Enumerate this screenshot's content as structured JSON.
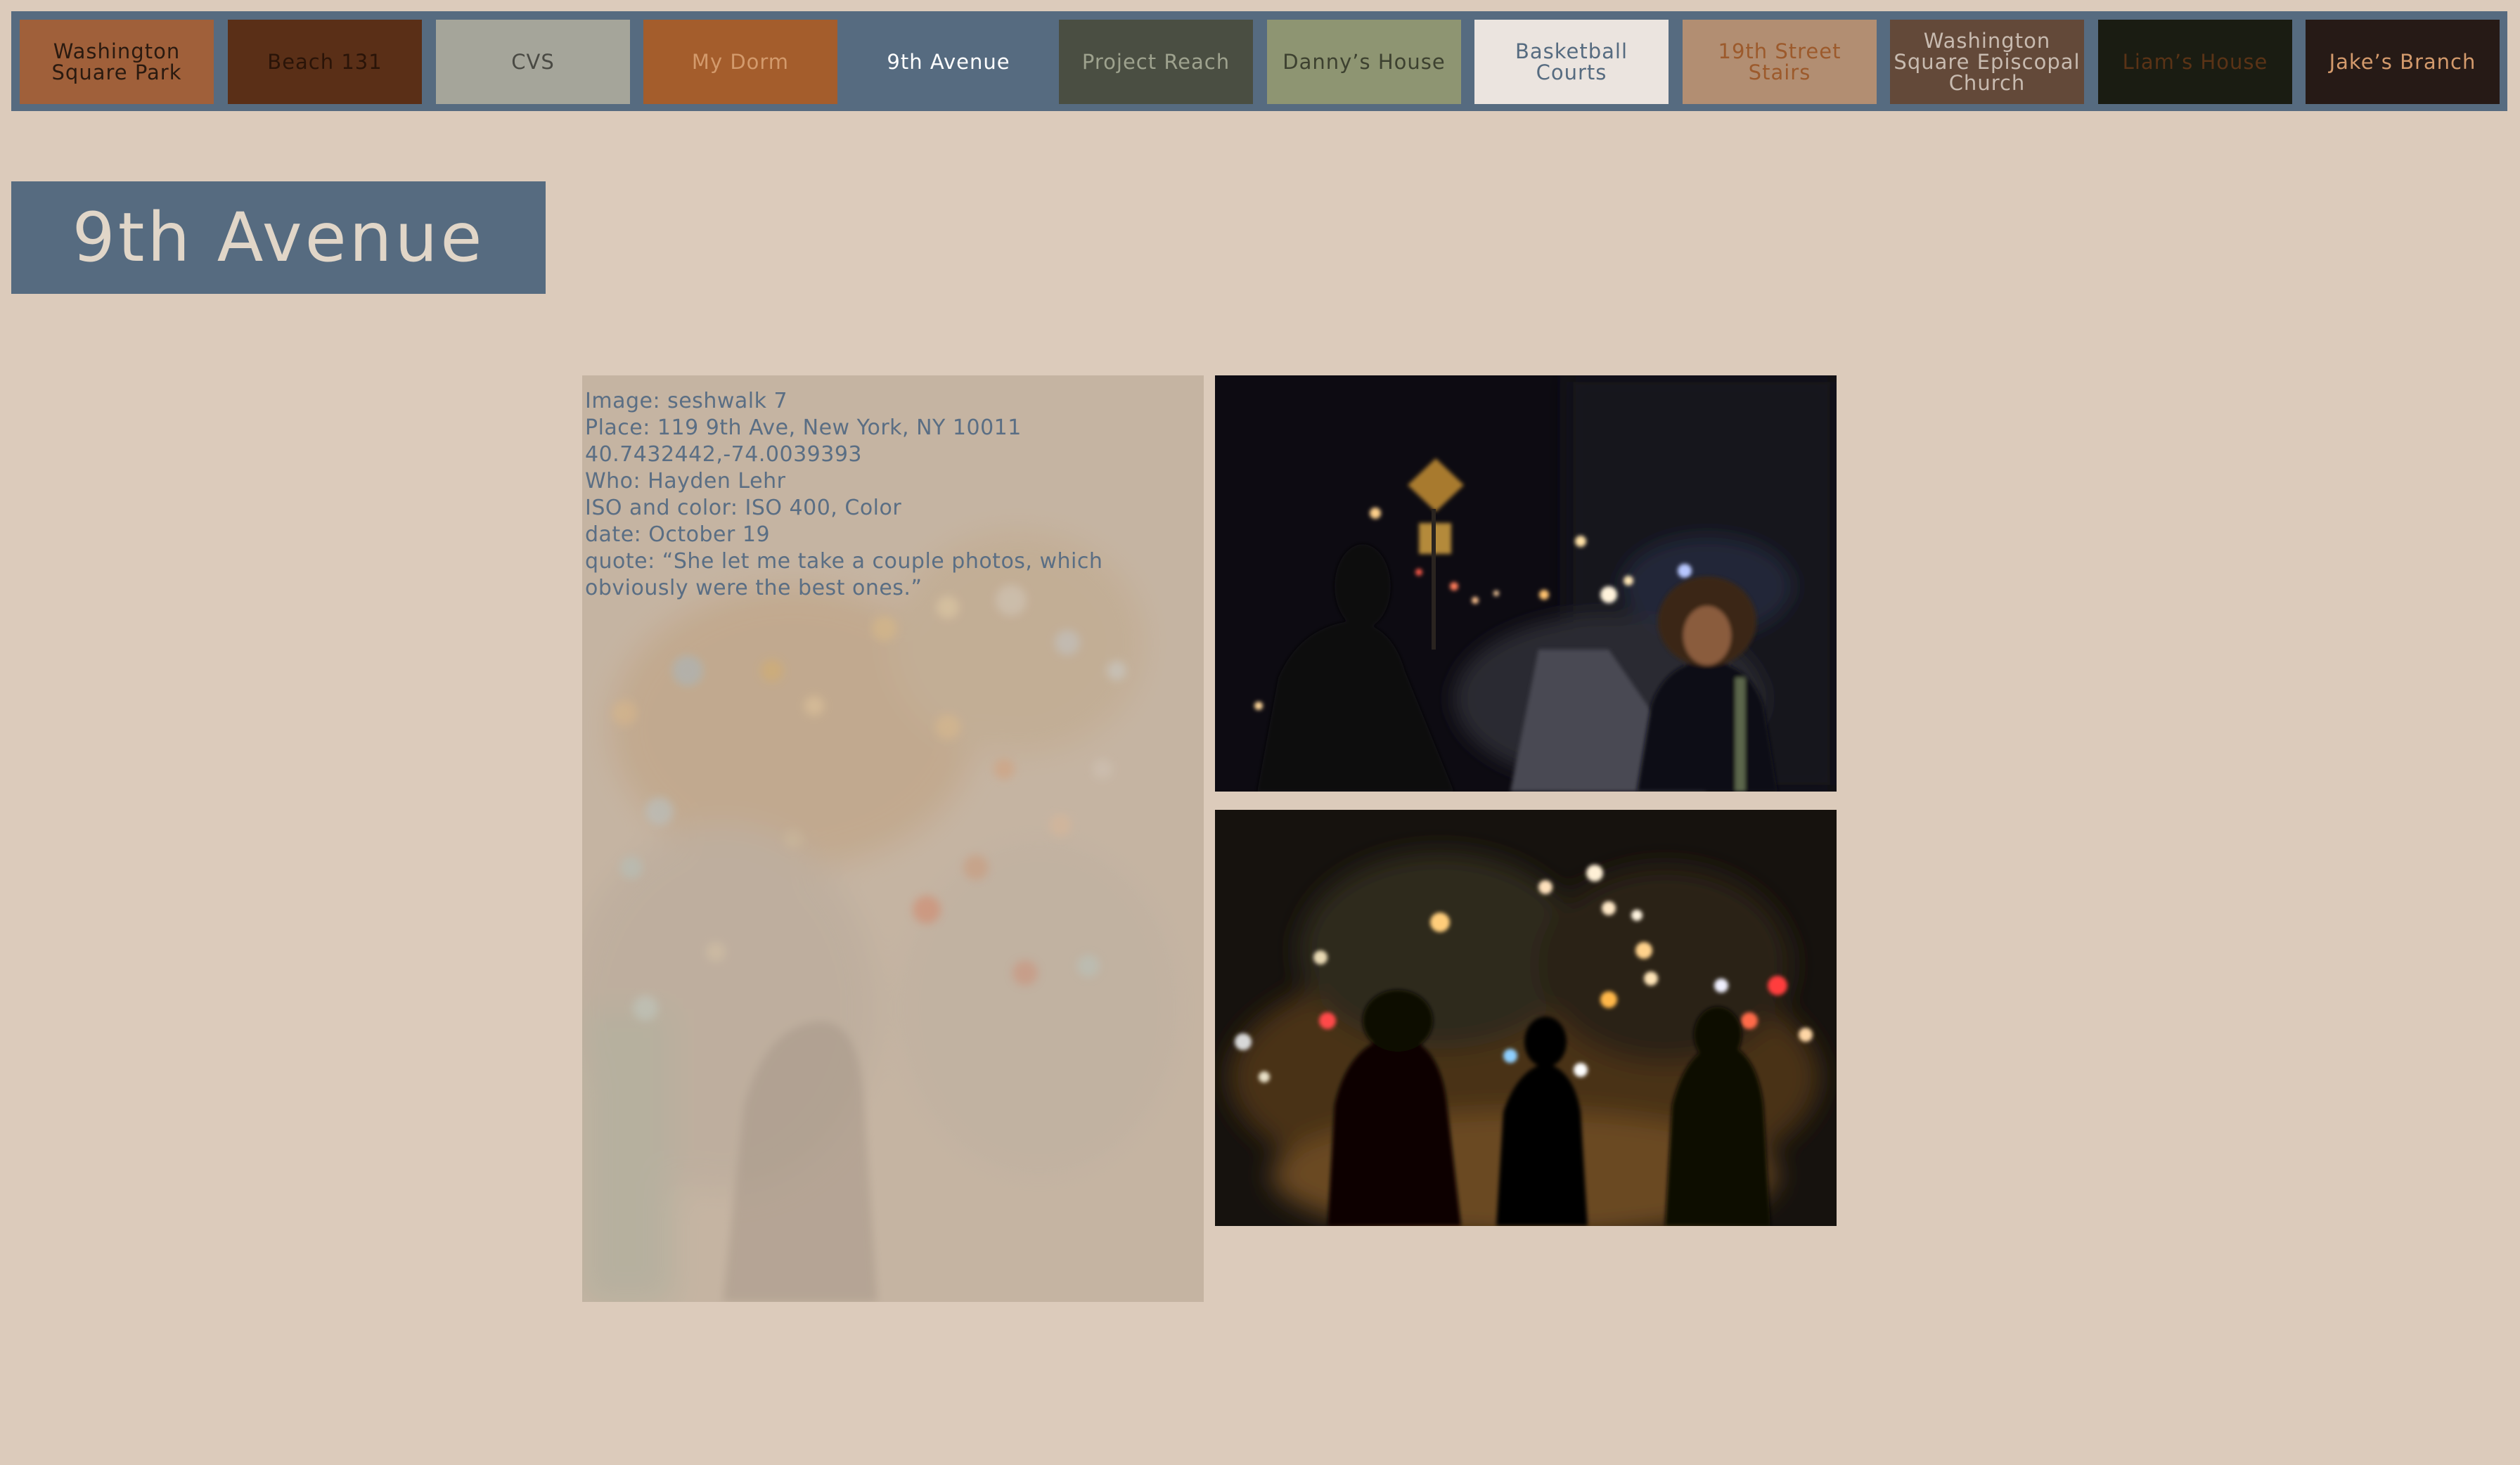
{
  "nav": {
    "items": [
      {
        "label": "Washington Square Park",
        "bg": "#a0603a",
        "fg": "#2a1a10"
      },
      {
        "label": "Beach 131",
        "bg": "#5a2f17",
        "fg": "#2a1408"
      },
      {
        "label": "CVS",
        "bg": "#a5a59a",
        "fg": "#4a4a44"
      },
      {
        "label": "My Dorm",
        "bg": "#a45d2c",
        "fg": "#d39a6c"
      },
      {
        "label": "9th Avenue",
        "bg": "#566b80",
        "fg": "#ffffff"
      },
      {
        "label": "Project Reach",
        "bg": "#4a4e42",
        "fg": "#9ea28e"
      },
      {
        "label": "Danny’s House",
        "bg": "#8e9572",
        "fg": "#3d4130"
      },
      {
        "label": "Basketball Courts",
        "bg": "#ebe4df",
        "fg": "#566b80"
      },
      {
        "label": "19th Street Stairs",
        "bg": "#b28e72",
        "fg": "#9c5a2c"
      },
      {
        "label": "Washington Square Episcopal Church",
        "bg": "#634939",
        "fg": "#c8bbb0"
      },
      {
        "label": "Liam’s House",
        "bg": "#1a1c12",
        "fg": "#5a3316"
      },
      {
        "label": "Jake’s Branch",
        "bg": "#261a16",
        "fg": "#d39a6c"
      }
    ]
  },
  "page": {
    "title": "9th Avenue"
  },
  "info": {
    "lines": [
      "Image: seshwalk 7",
      "Place: 119 9th Ave, New York, NY 10011",
      "40.7432442,-74.0039393",
      "Who: Hayden Lehr",
      "ISO and color: ISO 400, Color",
      "date: October 19",
      "quote: “She let me take a couple photos, which obviously were the best ones.”"
    ]
  },
  "colors": {
    "background": "#dccbbb",
    "accent": "#566b80",
    "info_text": "#5a6e84"
  }
}
